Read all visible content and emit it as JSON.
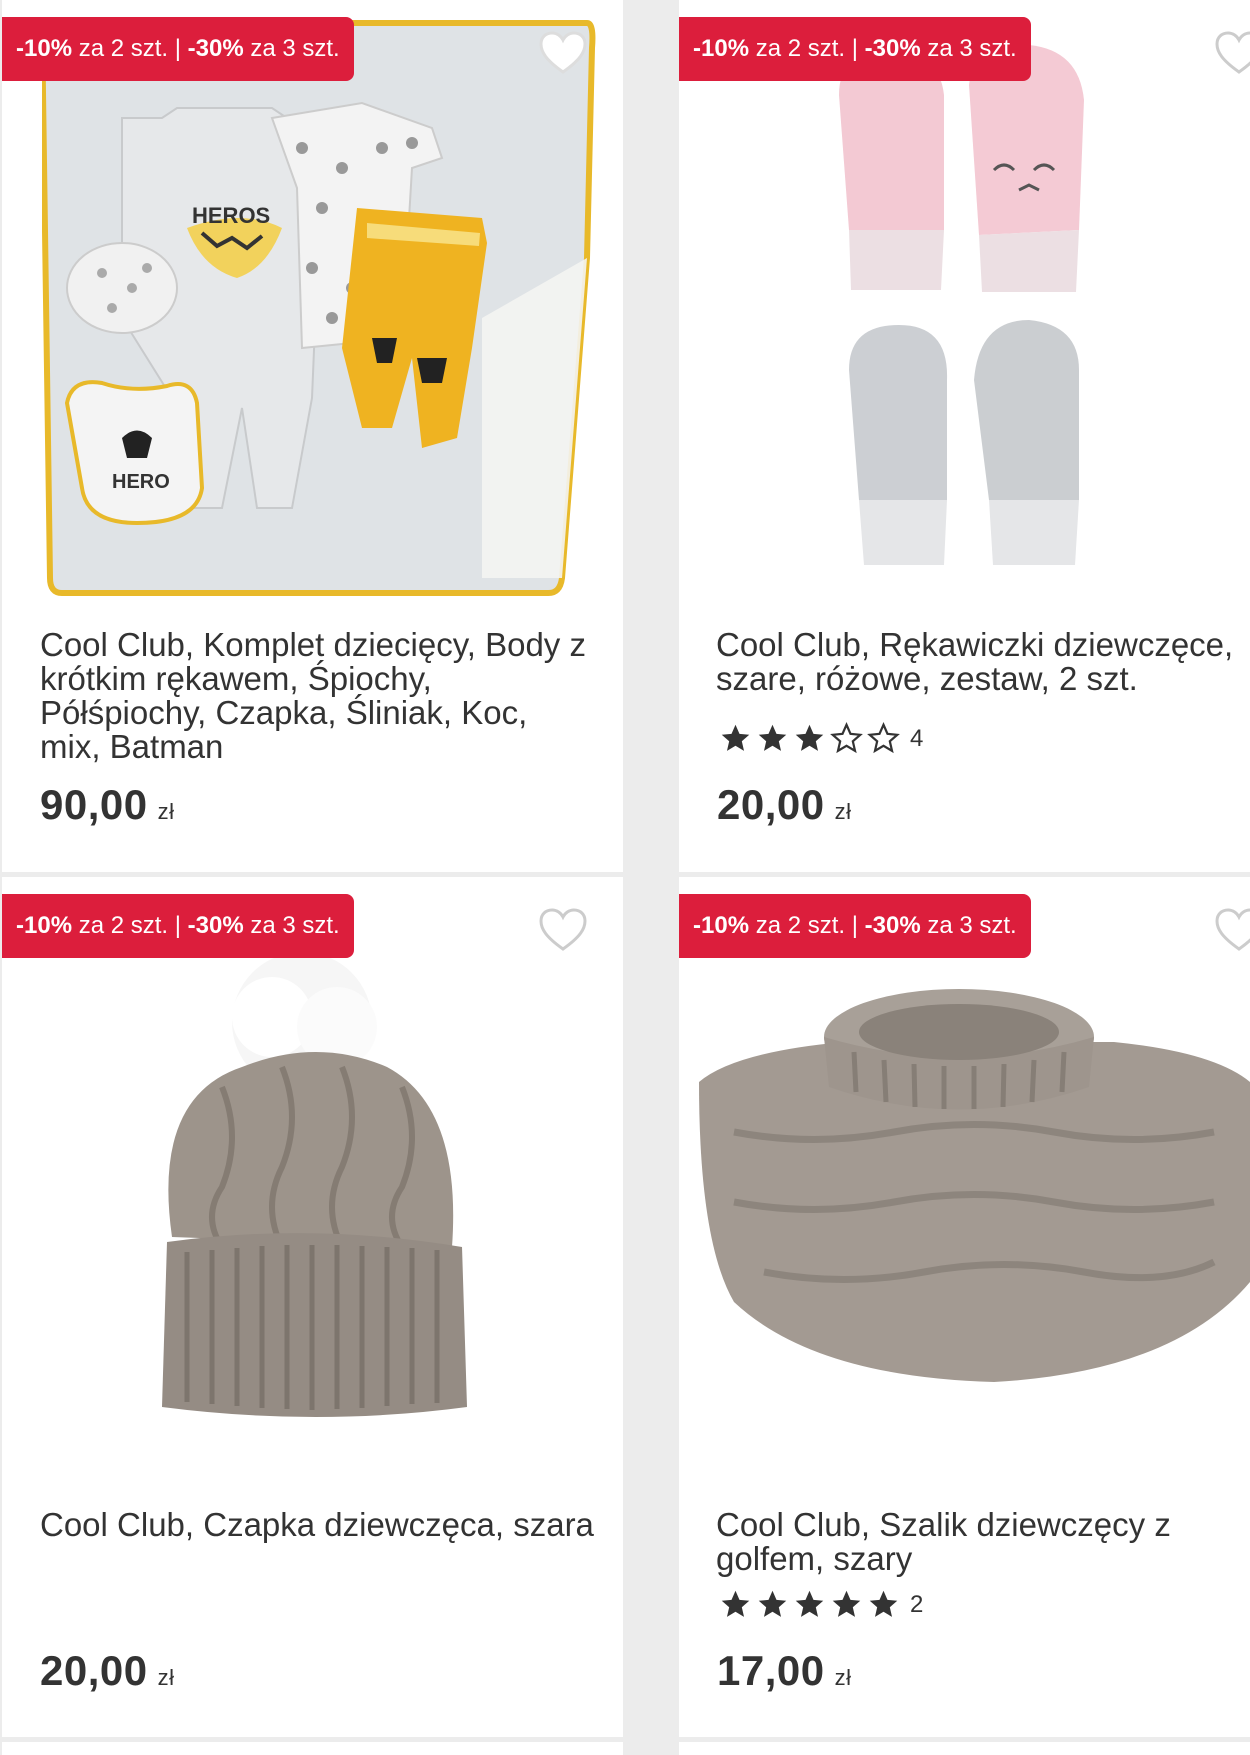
{
  "products": [
    {
      "promo_pct1": "-10%",
      "promo_text1": " za 2 szt. | ",
      "promo_pct2": "-30%",
      "promo_text2": " za 3 szt.",
      "title": "Cool Club, Komplet dziecięcy, Body z krótkim rękawem, Śpiochy, Półśpiochy, Czapka, Śliniak, Koc, mix, Batman",
      "price": "90,00",
      "currency": "zł"
    },
    {
      "promo_pct1": "-10%",
      "promo_text1": " za 2 szt. | ",
      "promo_pct2": "-30%",
      "promo_text2": " za 3 szt.",
      "title": "Cool Club, Rękawiczki dziewczęce, szare, różowe, zestaw, 2 szt.",
      "rating": 3,
      "rating_max": 5,
      "reviews": "4",
      "price": "20,00",
      "currency": "zł"
    },
    {
      "promo_pct1": "-10%",
      "promo_text1": " za 2 szt. | ",
      "promo_pct2": "-30%",
      "promo_text2": " za 3 szt.",
      "title": "Cool Club, Czapka dziewczęca, szara",
      "price": "20,00",
      "currency": "zł"
    },
    {
      "promo_pct1": "-10%",
      "promo_text1": " za 2 szt. | ",
      "promo_pct2": "-30%",
      "promo_text2": " za 3 szt.",
      "title": "Cool Club, Szalik dziewczęcy z golfem, szary",
      "rating": 5,
      "rating_max": 5,
      "reviews": "2",
      "price": "17,00",
      "currency": "zł"
    }
  ],
  "colors": {
    "promo_badge": "#dc1e3c",
    "text": "#333333",
    "background": "#ececec",
    "card": "#ffffff"
  },
  "icons": {
    "wishlist": "heart-outline-icon",
    "rating_full": "star-filled-icon",
    "rating_empty": "star-outline-icon"
  }
}
